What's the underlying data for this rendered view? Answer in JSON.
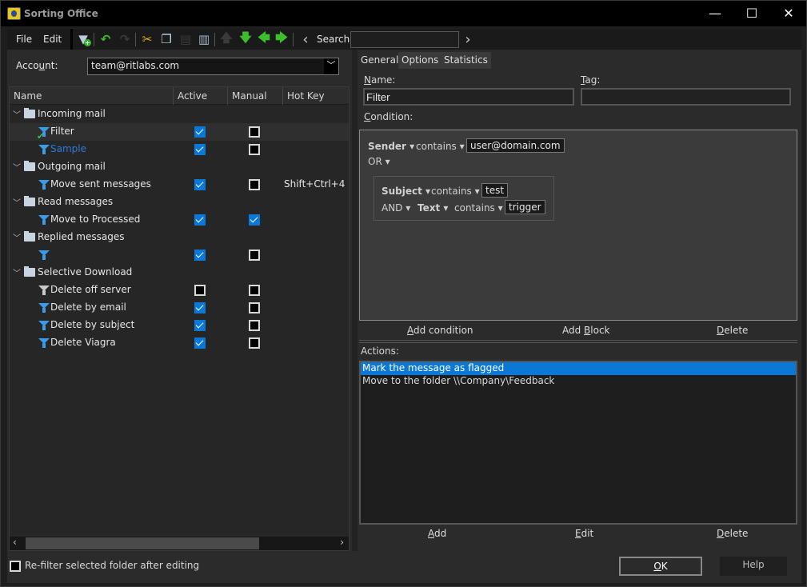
{
  "window": {
    "title": "Sorting Office",
    "controls": {
      "minimize": "—",
      "maximize": "☐",
      "close": "✕"
    }
  },
  "menu": {
    "file": "File",
    "edit": "Edit"
  },
  "toolbar": {
    "icons": [
      "new-filter-icon",
      "undo-icon",
      "redo-icon",
      "cut-icon",
      "copy-icon",
      "paste-icon",
      "delete-icon",
      "move-up-icon",
      "move-down-icon",
      "move-left-icon",
      "move-right-icon"
    ],
    "search_label": "Search",
    "search_value": "",
    "search_prev": "‹",
    "search_next": "›"
  },
  "account": {
    "label_pre": "Acco",
    "label_u": "u",
    "label_post": "nt:",
    "value": "team@ritlabs.com"
  },
  "tree": {
    "columns": [
      "Name",
      "Active",
      "Manual",
      "Hot Key"
    ],
    "rows": [
      {
        "type": "folder",
        "label": "Incoming mail"
      },
      {
        "type": "filter",
        "label": "Filter",
        "active": true,
        "manual": false,
        "hotkey": "",
        "selected": true,
        "icon": "filter-checked"
      },
      {
        "type": "filter",
        "label": "Sample",
        "active": true,
        "manual": false,
        "hotkey": "",
        "link": true
      },
      {
        "type": "folder",
        "label": "Outgoing mail"
      },
      {
        "type": "filter",
        "label": "Move sent messages",
        "active": true,
        "manual": false,
        "hotkey": "Shift+Ctrl+4"
      },
      {
        "type": "folder",
        "label": "Read messages"
      },
      {
        "type": "filter",
        "label": "Move to Processed",
        "active": true,
        "manual": true,
        "hotkey": ""
      },
      {
        "type": "folder",
        "label": "Replied messages"
      },
      {
        "type": "filter",
        "label": "",
        "active": true,
        "manual": false,
        "hotkey": ""
      },
      {
        "type": "folder",
        "label": "Selective Download"
      },
      {
        "type": "filter",
        "label": "Delete off server",
        "active": false,
        "manual": false,
        "hotkey": "",
        "icon": "gray"
      },
      {
        "type": "filter",
        "label": "Delete by email",
        "active": true,
        "manual": false,
        "hotkey": ""
      },
      {
        "type": "filter",
        "label": "Delete by subject",
        "active": true,
        "manual": false,
        "hotkey": ""
      },
      {
        "type": "filter",
        "label": "Delete Viagra",
        "active": true,
        "manual": false,
        "hotkey": ""
      }
    ]
  },
  "refilter": {
    "label": "Re-filter selected folder after editing",
    "checked": false
  },
  "tabs": [
    "General",
    "Options",
    "Statistics"
  ],
  "general": {
    "name_label_u": "N",
    "name_label_rest": "ame:",
    "name_value": "Filter",
    "tag_label_u": "T",
    "tag_label_rest": "ag:",
    "tag_value": "",
    "condition_label_u": "C",
    "condition_label_rest": "ondition:",
    "condition": {
      "field1": "Sender ▾",
      "op1": "contains ▾",
      "val1": "user@domain.com",
      "join1": "OR ▾",
      "block": {
        "field1": "Subject ▾",
        "op1": "contains ▾",
        "val1": "test",
        "join": "AND ▾",
        "field2": "Text ▾",
        "op2": "contains ▾",
        "val2": "trigger"
      }
    },
    "cond_buttons": {
      "add_condition_u": "A",
      "add_condition_rest": "dd condition",
      "add_block_pre": "Add ",
      "add_block_u": "B",
      "add_block_rest": "lock",
      "delete_u": "D",
      "delete_rest": "elete"
    },
    "actions_label": "Actions:",
    "actions": [
      {
        "label": "Mark the message as flagged",
        "selected": true
      },
      {
        "label": "Move to the folder \\\\Company\\Feedback",
        "selected": false
      }
    ],
    "action_buttons": {
      "add_u": "A",
      "add_rest": "dd",
      "edit_u": "E",
      "edit_rest": "dit",
      "delete_u": "D",
      "delete_rest": "elete"
    }
  },
  "footer": {
    "ok_u": "O",
    "ok_rest": "K",
    "help": "Help"
  }
}
